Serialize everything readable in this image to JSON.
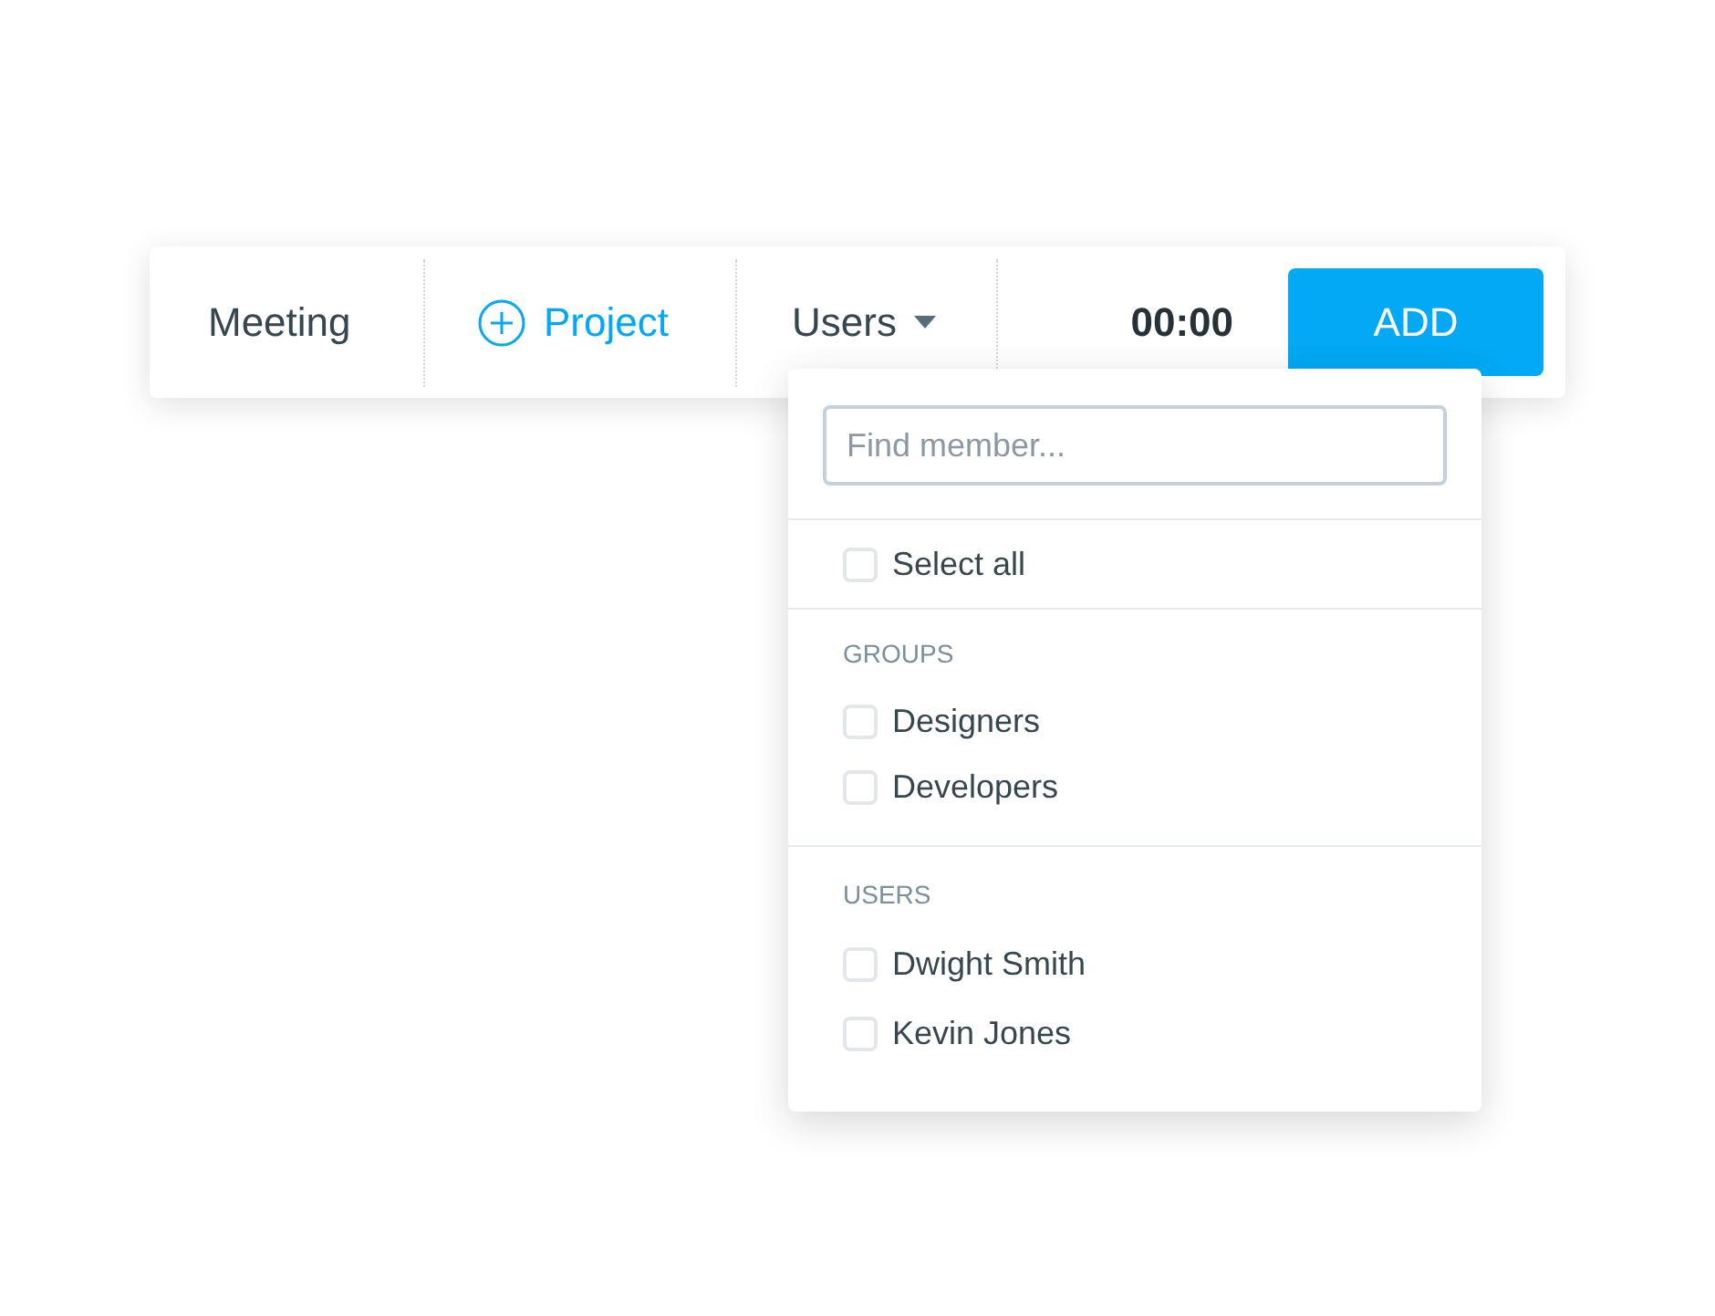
{
  "toolbar": {
    "description": "Meeting",
    "project_button": "Project",
    "users_dropdown": {
      "label": "Users",
      "expanded": true
    },
    "timer": "00:00",
    "add_button": "ADD"
  },
  "dropdown": {
    "search": {
      "placeholder": "Find member..."
    },
    "select_all": {
      "label": "Select all",
      "checked": false
    },
    "sections": [
      {
        "heading": "GROUPS",
        "items": [
          {
            "label": "Designers",
            "checked": false
          },
          {
            "label": "Developers",
            "checked": false
          }
        ]
      },
      {
        "heading": "USERS",
        "items": [
          {
            "label": "Dwight Smith",
            "checked": false
          },
          {
            "label": "Kevin Jones",
            "checked": false
          }
        ]
      }
    ]
  }
}
